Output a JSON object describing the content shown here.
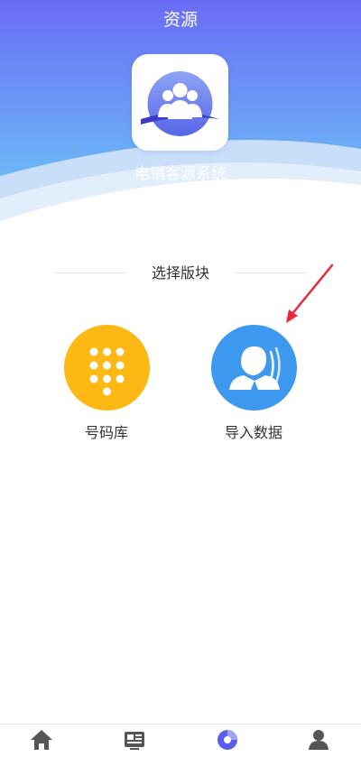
{
  "header": {
    "title": "资源",
    "app_name": "电销客源系统",
    "gradient_top": "#6b6ff5",
    "gradient_bottom": "#6fb4f5"
  },
  "section": {
    "title": "选择版块"
  },
  "modules": [
    {
      "label": "号码库",
      "icon": "keypad-icon",
      "color": "#fdb813"
    },
    {
      "label": "导入数据",
      "icon": "person-import-icon",
      "color": "#3d98f0"
    }
  ],
  "annotation": {
    "arrow_color": "#e8293b"
  },
  "tabbar": {
    "items": [
      {
        "icon": "home-icon",
        "active": false
      },
      {
        "icon": "news-icon",
        "active": false
      },
      {
        "icon": "resource-chart-icon",
        "active": true
      },
      {
        "icon": "user-icon",
        "active": false
      }
    ],
    "active_color": "#5a5ef0",
    "inactive_color": "#555555"
  }
}
